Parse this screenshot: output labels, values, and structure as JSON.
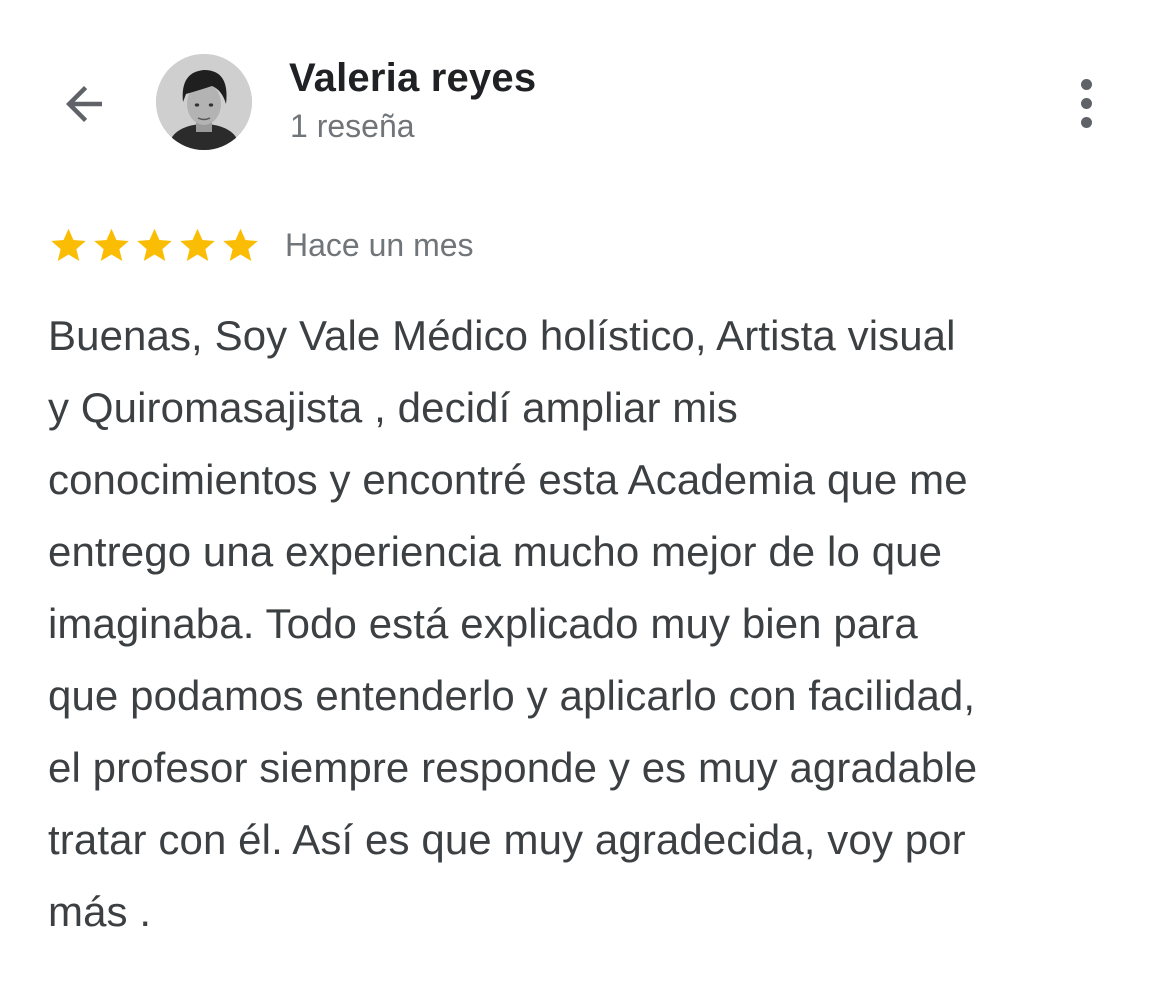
{
  "header": {
    "reviewer_name": "Valeria reyes",
    "reviewer_subtitle": "1 reseña"
  },
  "icons": {
    "back": "arrow-back-icon",
    "more": "more-vert-icon",
    "star": "star-icon"
  },
  "review": {
    "rating": 5,
    "rating_max": 5,
    "time": "Hace un mes",
    "text": "Buenas, Soy Vale Médico holístico, Artista visual\ny Quiromasajista , decidí ampliar mis\nconocimientos y encontré esta Academia que me\nentrego una experiencia mucho mejor de lo que\nimaginaba. Todo está explicado muy bien para\nque podamos entenderlo y aplicarlo con facilidad,\nel profesor siempre responde y es muy agradable\ntratar con él. Así es que muy agradecida, voy por\nmás ."
  },
  "colors": {
    "star": "#fbbc04",
    "title": "#202124",
    "secondary": "#70757a",
    "body_text": "#3c4043",
    "icon": "#5f6368"
  }
}
